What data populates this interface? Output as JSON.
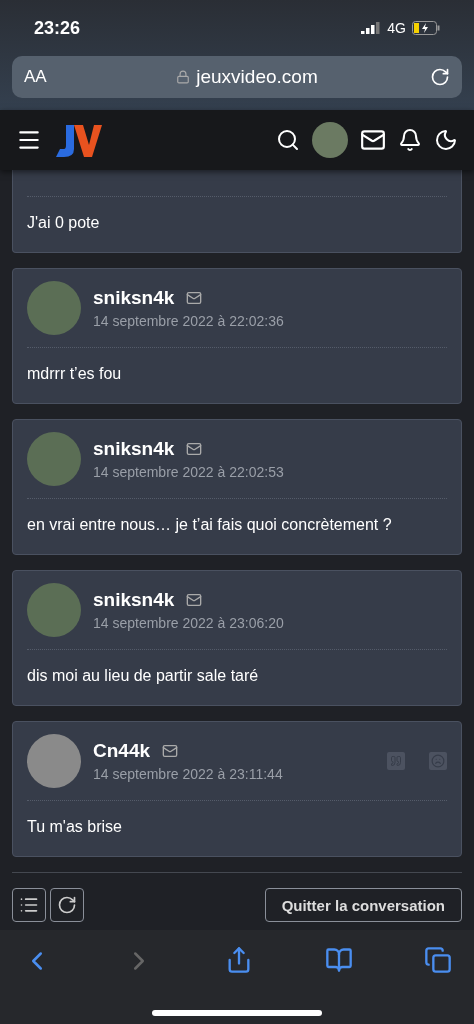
{
  "status_bar": {
    "time": "23:26",
    "network": "4G"
  },
  "url_bar": {
    "text_size": "AA",
    "domain": "jeuxvideo.com"
  },
  "messages": [
    {
      "kind": "partial",
      "body": "J'ai 0 pote"
    },
    {
      "kind": "full",
      "author": "sniksn4k",
      "date": "14 septembre 2022 à 22:02:36",
      "body": "mdrrr t’es fou",
      "actions": false
    },
    {
      "kind": "full",
      "author": "sniksn4k",
      "date": "14 septembre 2022 à 22:02:53",
      "body": "en vrai entre nous… je t’ai fais quoi concrètement ?",
      "actions": false
    },
    {
      "kind": "full",
      "author": "sniksn4k",
      "date": "14 septembre 2022 à 23:06:20",
      "body": "dis moi au lieu de partir sale taré",
      "actions": false
    },
    {
      "kind": "full",
      "author": "Cn44k",
      "date": "14 septembre 2022 à 23:11:44",
      "body": "Tu m'as brise",
      "actions": true
    }
  ],
  "leave_button": "Quitter la conversation"
}
